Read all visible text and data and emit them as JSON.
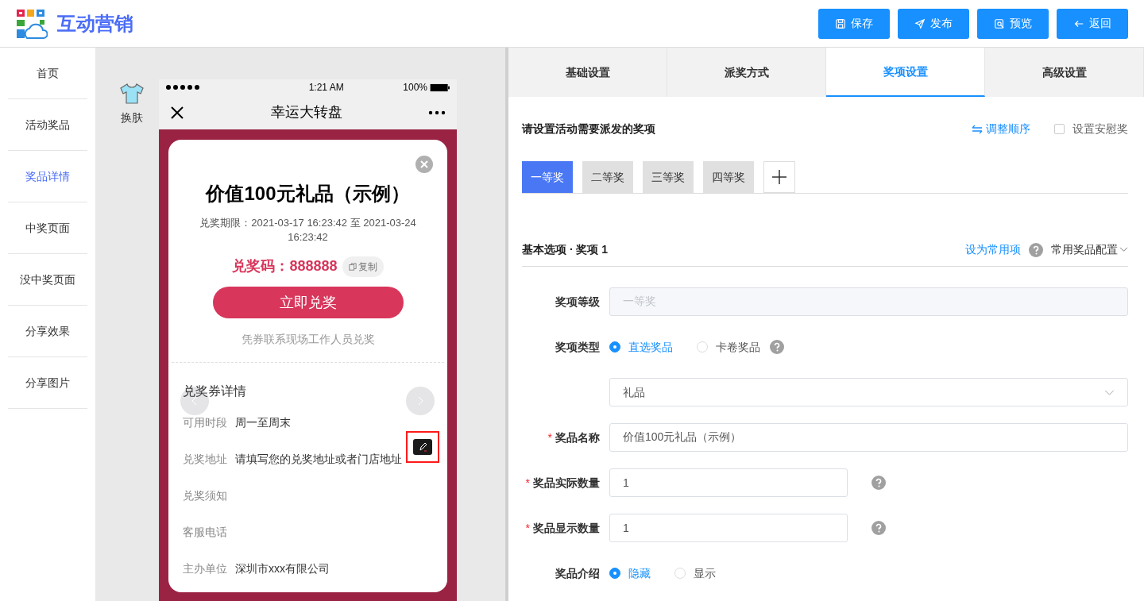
{
  "header": {
    "app_title": "互动营销",
    "buttons": [
      {
        "label": "保存"
      },
      {
        "label": "发布"
      },
      {
        "label": "预览"
      },
      {
        "label": "返回"
      }
    ]
  },
  "sidebar": {
    "items": [
      {
        "label": "首页",
        "selected": false
      },
      {
        "label": "活动奖品",
        "selected": false
      },
      {
        "label": "奖品详情",
        "selected": true
      },
      {
        "label": "中奖页面",
        "selected": false
      },
      {
        "label": "没中奖页面",
        "selected": false
      },
      {
        "label": "分享效果",
        "selected": false
      },
      {
        "label": "分享图片",
        "selected": false
      }
    ]
  },
  "preview": {
    "skin_label": "换肤",
    "status_time": "1:21 AM",
    "battery": "100%",
    "nav_title": "幸运大转盘",
    "prize_title": "价值100元礼品（示例）",
    "validity": "兑奖期限：2021-03-17 16:23:42 至 2021-03-24 16:23:42",
    "code_label": "兑奖码：",
    "code": "888888",
    "copy_button": "复制",
    "redeem_button": "立即兑奖",
    "hint": "凭券联系现场工作人员兑奖",
    "details_title": "兑奖券详情",
    "details": [
      {
        "label": "可用时段",
        "value": "周一至周末",
        "editing": false
      },
      {
        "label": "兑奖地址",
        "value": "请填写您的兑奖地址或者门店地址",
        "editing": true
      },
      {
        "label": "兑奖须知",
        "editing": false
      },
      {
        "label": "客服电话",
        "editing": false
      },
      {
        "label": "主办单位",
        "value": "深圳市xxx有限公司",
        "editing": false
      }
    ]
  },
  "tabs": [
    {
      "label": "基础设置",
      "selected": false
    },
    {
      "label": "派奖方式",
      "selected": false
    },
    {
      "label": "奖项设置",
      "selected": true
    },
    {
      "label": "高级设置",
      "selected": false
    }
  ],
  "prizes": {
    "heading": "请设置活动需要派发的奖项",
    "reorder_link": "调整顺序",
    "consolation": {
      "label": "设置安慰奖",
      "checked": false
    },
    "tabs": [
      {
        "label": "一等奖",
        "selected": true
      },
      {
        "label": "二等奖",
        "selected": false
      },
      {
        "label": "三等奖",
        "selected": false
      },
      {
        "label": "四等奖",
        "selected": false
      }
    ]
  },
  "basic": {
    "heading": "基本选项 · 奖项 1",
    "set_common": "设为常用项",
    "common_config": "常用奖品配置"
  },
  "form": [
    {
      "kind": "input",
      "label": "奖项等级",
      "value": "一等奖",
      "disabled": true,
      "short": false,
      "help": false
    },
    {
      "kind": "radio",
      "label": "奖项类型",
      "options": [
        {
          "label": "直选奖品",
          "selected": true
        },
        {
          "label": "卡卷奖品",
          "selected": false
        }
      ],
      "help": true
    },
    {
      "kind": "select",
      "value": "礼品"
    },
    {
      "kind": "input",
      "label": "奖品名称",
      "required_mark": "*",
      "value": "价值100元礼品（示例）",
      "disabled": false,
      "short": false,
      "help": false
    },
    {
      "kind": "input",
      "label": "奖品实际数量",
      "required_mark": "*",
      "value": "1",
      "disabled": false,
      "short": true,
      "help": true
    },
    {
      "kind": "input",
      "label": "奖品显示数量",
      "required_mark": "*",
      "value": "1",
      "disabled": false,
      "short": true,
      "help": true
    },
    {
      "kind": "radio",
      "label": "奖品介绍",
      "options": [
        {
          "label": "隐藏",
          "selected": true
        },
        {
          "label": "显示",
          "selected": false
        }
      ],
      "help": false
    }
  ]
}
